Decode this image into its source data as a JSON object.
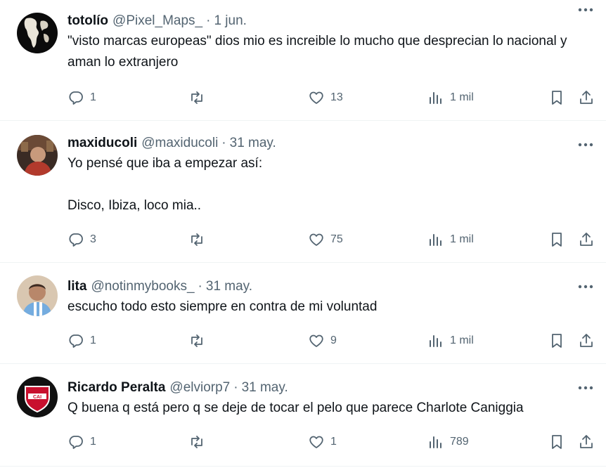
{
  "tweets": [
    {
      "name": "totolío",
      "handle": "@Pixel_Maps_",
      "separator": "·",
      "date": "1 jun.",
      "text": "\"visto marcas europeas\" dios mio es increible lo mucho que desprecian lo nacional y aman lo extranjero",
      "replies": "1",
      "retweets": "",
      "likes": "13",
      "views": "1 mil",
      "avatar": "world-map-avatar"
    },
    {
      "name": "maxiducoli",
      "handle": "@maxiducoli",
      "separator": "·",
      "date": "31 may.",
      "text": "Yo pensé que iba a empezar así:\n\nDisco, Ibiza, loco mia..",
      "replies": "3",
      "retweets": "",
      "likes": "75",
      "views": "1 mil",
      "avatar": "person-photo-avatar"
    },
    {
      "name": "lita",
      "handle": "@notinmybooks_",
      "separator": "·",
      "date": "31 may.",
      "text": "escucho todo esto siempre en contra de mi voluntad",
      "replies": "1",
      "retweets": "",
      "likes": "9",
      "views": "1 mil",
      "avatar": "person-photo-avatar"
    },
    {
      "name": "Ricardo Peralta",
      "handle": "@elviorp7",
      "separator": "·",
      "date": "31 may.",
      "text": "Q buena q está pero q se deje de tocar el pelo que parece Charlote Caniggia",
      "replies": "1",
      "retweets": "",
      "likes": "1",
      "views": "789",
      "avatar": "club-crest-avatar"
    }
  ],
  "colors": {
    "text": "#0f1419",
    "secondary": "#536471",
    "divider": "#eff3f4"
  }
}
